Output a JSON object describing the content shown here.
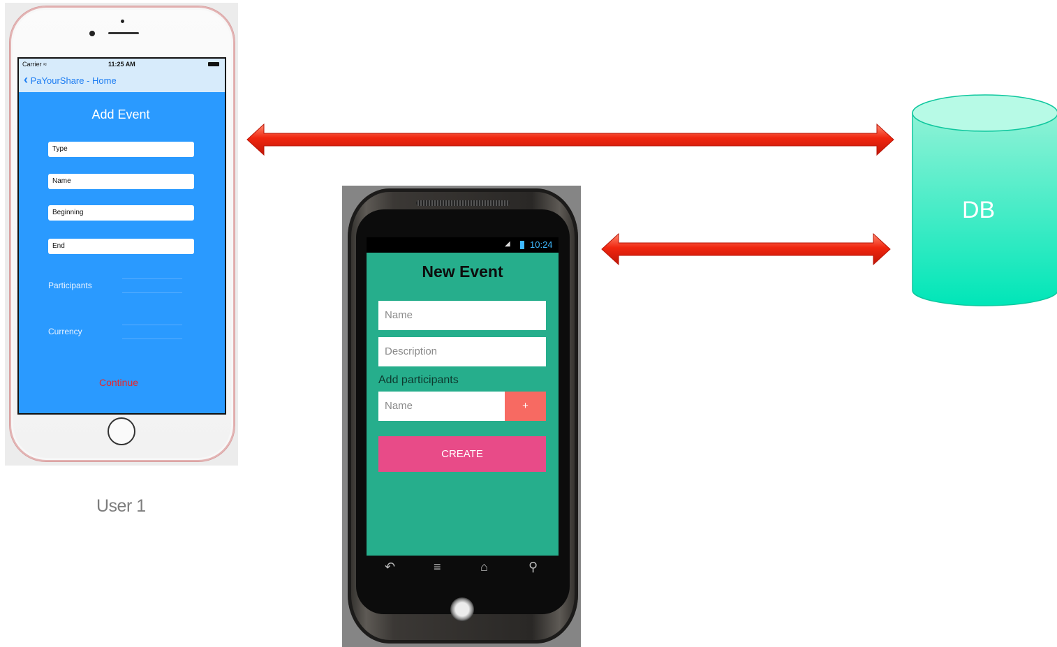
{
  "ios_app": {
    "status": {
      "carrier": "Carrier",
      "time": "11:25 AM"
    },
    "nav_back": "PaYourShare - Home",
    "title": "Add Event",
    "fields": [
      "Type",
      "Name",
      "Beginning",
      "End"
    ],
    "labels": {
      "participants": "Participants",
      "currency": "Currency"
    },
    "continue": "Continue"
  },
  "user_label": "User 1",
  "db_label": "DB",
  "android_app": {
    "status": {
      "time": "10:24"
    },
    "title": "New Event",
    "name_placeholder": "Name",
    "description_placeholder": "Description",
    "add_participants_label": "Add participants",
    "participant_placeholder": "Name",
    "add_button": "+",
    "create_button": "CREATE"
  },
  "colors": {
    "ios_background": "#2a9aff",
    "android_background": "#26ae8c",
    "arrow": "#e8210f",
    "db": "#19e6b8",
    "create_button": "#e84b88",
    "add_button": "#f76a62",
    "continue_text": "#e8262b"
  }
}
